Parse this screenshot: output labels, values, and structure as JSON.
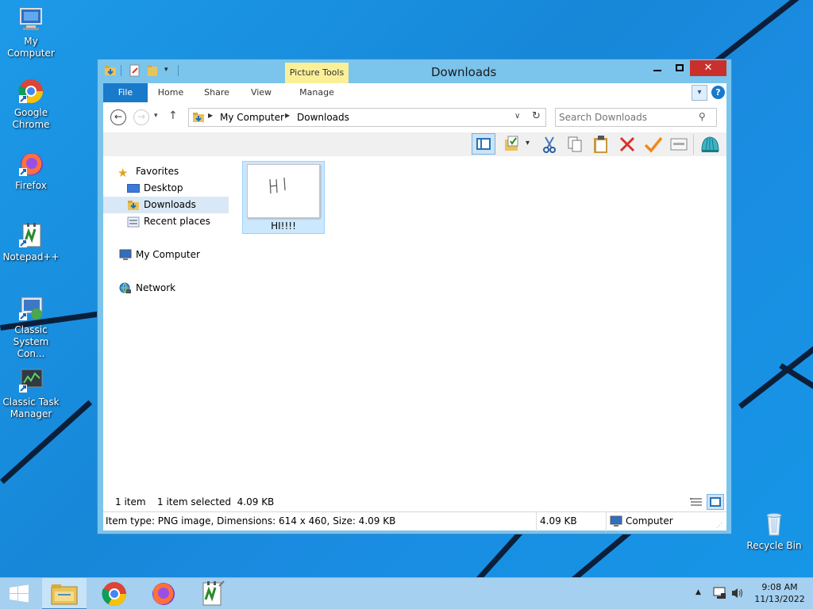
{
  "desktop": {
    "icons": [
      {
        "label": "My Computer"
      },
      {
        "label": "Google Chrome"
      },
      {
        "label": "Firefox"
      },
      {
        "label": "Notepad++"
      },
      {
        "label": "Classic System Con..."
      },
      {
        "label": "Classic Task Manager"
      },
      {
        "label": "Recycle Bin"
      }
    ]
  },
  "window": {
    "title": "Downloads",
    "tools_tab": "Picture Tools",
    "tabs": [
      "File",
      "Home",
      "Share",
      "View",
      "Manage"
    ],
    "address": {
      "crumbs": [
        "My Computer",
        "Downloads"
      ]
    },
    "search": {
      "placeholder": "Search Downloads"
    },
    "nav": {
      "favorites": "Favorites",
      "desktop": "Desktop",
      "downloads": "Downloads",
      "recent": "Recent places",
      "computer": "My Computer",
      "network": "Network"
    },
    "file": {
      "name": "HI!!!!",
      "thumb_text": "HI"
    },
    "status": {
      "count": "1 item",
      "selected": "1 item selected  4.09 KB"
    },
    "details": {
      "info": "Item type: PNG image, Dimensions: 614 x 460, Size: 4.09 KB",
      "size": "4.09 KB",
      "location": "Computer"
    }
  },
  "taskbar": {
    "time": "9:08 AM",
    "date": "11/13/2022"
  },
  "colors": {
    "accent": "#1979ca",
    "selection": "#cce8ff",
    "picture_tools": "#fbf098",
    "taskbar": "#a5d0ef"
  }
}
